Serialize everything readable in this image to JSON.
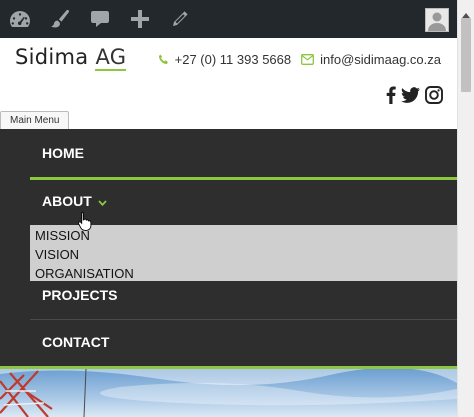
{
  "admin_bar": {
    "items": [
      "dashboard-icon",
      "customize-brush-icon",
      "comments-icon",
      "add-new-icon",
      "edit-pencil-icon"
    ]
  },
  "header": {
    "logo_main": "Sidima",
    "logo_suffix": "AG",
    "phone": "+27 (0) 11 393 5668",
    "email": "info@sidimaag.co.za",
    "social": [
      "facebook-icon",
      "twitter-icon",
      "instagram-icon"
    ]
  },
  "menu_toggle": {
    "label": "Main Menu"
  },
  "nav": {
    "home": "HOME",
    "about": "ABOUT",
    "about_submenu": [
      "MISSION",
      "VISION",
      "ORGANISATION"
    ],
    "projects": "PROJECTS",
    "contact": "CONTACT"
  },
  "colors": {
    "accent": "#8dc63f",
    "nav_bg": "#2e2e2e",
    "admin_bar_bg": "#23282d",
    "submenu_bg": "#cfcfcf"
  }
}
